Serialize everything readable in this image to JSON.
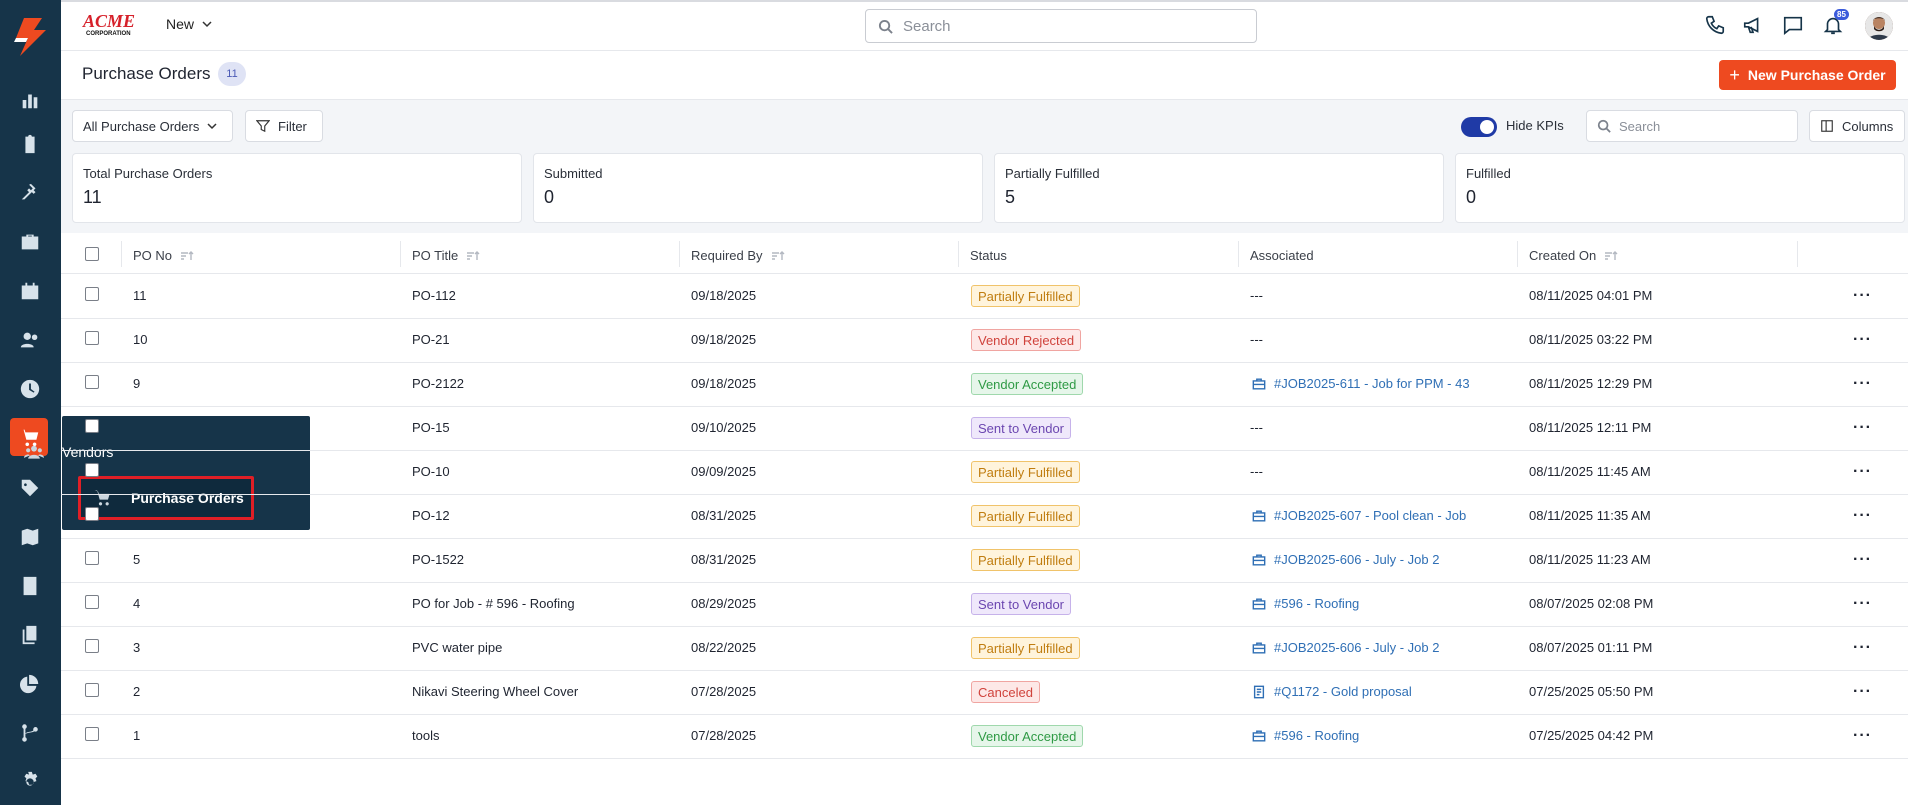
{
  "topbar": {
    "brand": "ACME CORPORATION",
    "new_label": "New",
    "search_placeholder": "Search",
    "notification_count": "85"
  },
  "sidebar_flyout": {
    "items": [
      {
        "label": "Vendors",
        "icon": "users-icon"
      },
      {
        "label": "Purchase Orders",
        "icon": "cart-icon"
      }
    ]
  },
  "page": {
    "title": "Purchase Orders",
    "count": "11",
    "new_button": "New Purchase Order"
  },
  "toolbar": {
    "view_select": "All Purchase Orders",
    "filter_label": "Filter",
    "hide_kpis_label": "Hide KPIs",
    "hide_kpis_on": true,
    "search_placeholder": "Search",
    "columns_label": "Columns"
  },
  "kpis": [
    {
      "label": "Total Purchase Orders",
      "value": "11"
    },
    {
      "label": "Submitted",
      "value": "0"
    },
    {
      "label": "Partially Fulfilled",
      "value": "5"
    },
    {
      "label": "Fulfilled",
      "value": "0"
    }
  ],
  "table": {
    "headers": [
      "PO No",
      "PO Title",
      "Required By",
      "Status",
      "Associated",
      "Created On"
    ],
    "rows": [
      {
        "po_no": "11",
        "title": "PO-112",
        "required": "09/18/2025",
        "status": "Partially Fulfilled",
        "associated": "---",
        "created": "08/11/2025 04:01 PM"
      },
      {
        "po_no": "10",
        "title": "PO-21",
        "required": "09/18/2025",
        "status": "Vendor Rejected",
        "associated": "---",
        "created": "08/11/2025 03:22 PM"
      },
      {
        "po_no": "9",
        "title": "PO-2122",
        "required": "09/18/2025",
        "status": "Vendor Accepted",
        "associated": "#JOB2025-611 - Job for PPM - 43",
        "created": "08/11/2025 12:29 PM"
      },
      {
        "po_no": "",
        "title": "PO-15",
        "required": "09/10/2025",
        "status": "Sent to Vendor",
        "associated": "---",
        "created": "08/11/2025 12:11 PM"
      },
      {
        "po_no": "",
        "title": "PO-10",
        "required": "09/09/2025",
        "status": "Partially Fulfilled",
        "associated": "---",
        "created": "08/11/2025 11:45 AM"
      },
      {
        "po_no": "",
        "title": "PO-12",
        "required": "08/31/2025",
        "status": "Partially Fulfilled",
        "associated": "#JOB2025-607 - Pool clean - Job",
        "created": "08/11/2025 11:35 AM"
      },
      {
        "po_no": "5",
        "title": "PO-1522",
        "required": "08/31/2025",
        "status": "Partially Fulfilled",
        "associated": "#JOB2025-606 - July - Job 2",
        "created": "08/11/2025 11:23 AM"
      },
      {
        "po_no": "4",
        "title": "PO for Job - # 596 - Roofing",
        "required": "08/29/2025",
        "status": "Sent to Vendor",
        "associated": "#596 - Roofing",
        "created": "08/07/2025 02:08 PM"
      },
      {
        "po_no": "3",
        "title": "PVC water pipe",
        "required": "08/22/2025",
        "status": "Partially Fulfilled",
        "associated": "#JOB2025-606 - July - Job 2",
        "created": "08/07/2025 01:11 PM"
      },
      {
        "po_no": "2",
        "title": "Nikavi Steering Wheel Cover",
        "required": "07/28/2025",
        "status": "Canceled",
        "associated": "#Q1172 - Gold proposal",
        "created": "07/25/2025 05:50 PM"
      },
      {
        "po_no": "1",
        "title": "tools",
        "required": "07/28/2025",
        "status": "Vendor Accepted",
        "associated": "#596 - Roofing",
        "created": "07/25/2025 04:42 PM"
      }
    ]
  },
  "status_colors": {
    "Partially Fulfilled": {
      "fg": "#c07d10",
      "bg": "#fff4dc",
      "border": "#f0c36a"
    },
    "Vendor Rejected": {
      "fg": "#d0433c",
      "bg": "#fde8e7",
      "border": "#f0a5a1"
    },
    "Vendor Accepted": {
      "fg": "#2f9a45",
      "bg": "#e6f6ea",
      "border": "#9fd8ac"
    },
    "Sent to Vendor": {
      "fg": "#6b46b0",
      "bg": "#efe8fb",
      "border": "#c6b2ea"
    },
    "Canceled": {
      "fg": "#d0433c",
      "bg": "#fde8e7",
      "border": "#f0a5a1"
    }
  },
  "accent": "#ee4a20",
  "sidebar_bg": "#163449"
}
